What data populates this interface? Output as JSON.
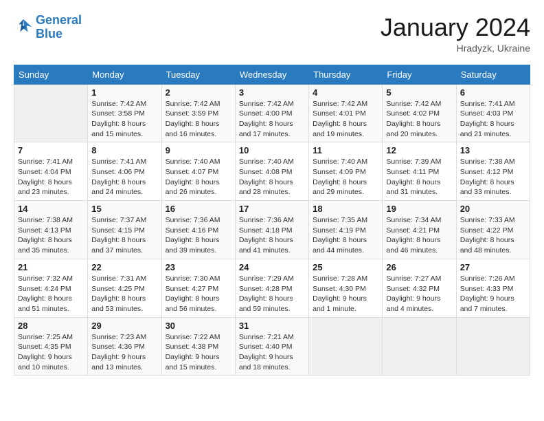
{
  "header": {
    "logo_line1": "General",
    "logo_line2": "Blue",
    "month_title": "January 2024",
    "location": "Hradyzk, Ukraine"
  },
  "days_of_week": [
    "Sunday",
    "Monday",
    "Tuesday",
    "Wednesday",
    "Thursday",
    "Friday",
    "Saturday"
  ],
  "weeks": [
    [
      {
        "day": "",
        "detail": ""
      },
      {
        "day": "1",
        "detail": "Sunrise: 7:42 AM\nSunset: 3:58 PM\nDaylight: 8 hours\nand 15 minutes."
      },
      {
        "day": "2",
        "detail": "Sunrise: 7:42 AM\nSunset: 3:59 PM\nDaylight: 8 hours\nand 16 minutes."
      },
      {
        "day": "3",
        "detail": "Sunrise: 7:42 AM\nSunset: 4:00 PM\nDaylight: 8 hours\nand 17 minutes."
      },
      {
        "day": "4",
        "detail": "Sunrise: 7:42 AM\nSunset: 4:01 PM\nDaylight: 8 hours\nand 19 minutes."
      },
      {
        "day": "5",
        "detail": "Sunrise: 7:42 AM\nSunset: 4:02 PM\nDaylight: 8 hours\nand 20 minutes."
      },
      {
        "day": "6",
        "detail": "Sunrise: 7:41 AM\nSunset: 4:03 PM\nDaylight: 8 hours\nand 21 minutes."
      }
    ],
    [
      {
        "day": "7",
        "detail": "Sunrise: 7:41 AM\nSunset: 4:04 PM\nDaylight: 8 hours\nand 23 minutes."
      },
      {
        "day": "8",
        "detail": "Sunrise: 7:41 AM\nSunset: 4:06 PM\nDaylight: 8 hours\nand 24 minutes."
      },
      {
        "day": "9",
        "detail": "Sunrise: 7:40 AM\nSunset: 4:07 PM\nDaylight: 8 hours\nand 26 minutes."
      },
      {
        "day": "10",
        "detail": "Sunrise: 7:40 AM\nSunset: 4:08 PM\nDaylight: 8 hours\nand 28 minutes."
      },
      {
        "day": "11",
        "detail": "Sunrise: 7:40 AM\nSunset: 4:09 PM\nDaylight: 8 hours\nand 29 minutes."
      },
      {
        "day": "12",
        "detail": "Sunrise: 7:39 AM\nSunset: 4:11 PM\nDaylight: 8 hours\nand 31 minutes."
      },
      {
        "day": "13",
        "detail": "Sunrise: 7:38 AM\nSunset: 4:12 PM\nDaylight: 8 hours\nand 33 minutes."
      }
    ],
    [
      {
        "day": "14",
        "detail": "Sunrise: 7:38 AM\nSunset: 4:13 PM\nDaylight: 8 hours\nand 35 minutes."
      },
      {
        "day": "15",
        "detail": "Sunrise: 7:37 AM\nSunset: 4:15 PM\nDaylight: 8 hours\nand 37 minutes."
      },
      {
        "day": "16",
        "detail": "Sunrise: 7:36 AM\nSunset: 4:16 PM\nDaylight: 8 hours\nand 39 minutes."
      },
      {
        "day": "17",
        "detail": "Sunrise: 7:36 AM\nSunset: 4:18 PM\nDaylight: 8 hours\nand 41 minutes."
      },
      {
        "day": "18",
        "detail": "Sunrise: 7:35 AM\nSunset: 4:19 PM\nDaylight: 8 hours\nand 44 minutes."
      },
      {
        "day": "19",
        "detail": "Sunrise: 7:34 AM\nSunset: 4:21 PM\nDaylight: 8 hours\nand 46 minutes."
      },
      {
        "day": "20",
        "detail": "Sunrise: 7:33 AM\nSunset: 4:22 PM\nDaylight: 8 hours\nand 48 minutes."
      }
    ],
    [
      {
        "day": "21",
        "detail": "Sunrise: 7:32 AM\nSunset: 4:24 PM\nDaylight: 8 hours\nand 51 minutes."
      },
      {
        "day": "22",
        "detail": "Sunrise: 7:31 AM\nSunset: 4:25 PM\nDaylight: 8 hours\nand 53 minutes."
      },
      {
        "day": "23",
        "detail": "Sunrise: 7:30 AM\nSunset: 4:27 PM\nDaylight: 8 hours\nand 56 minutes."
      },
      {
        "day": "24",
        "detail": "Sunrise: 7:29 AM\nSunset: 4:28 PM\nDaylight: 8 hours\nand 59 minutes."
      },
      {
        "day": "25",
        "detail": "Sunrise: 7:28 AM\nSunset: 4:30 PM\nDaylight: 9 hours\nand 1 minute."
      },
      {
        "day": "26",
        "detail": "Sunrise: 7:27 AM\nSunset: 4:32 PM\nDaylight: 9 hours\nand 4 minutes."
      },
      {
        "day": "27",
        "detail": "Sunrise: 7:26 AM\nSunset: 4:33 PM\nDaylight: 9 hours\nand 7 minutes."
      }
    ],
    [
      {
        "day": "28",
        "detail": "Sunrise: 7:25 AM\nSunset: 4:35 PM\nDaylight: 9 hours\nand 10 minutes."
      },
      {
        "day": "29",
        "detail": "Sunrise: 7:23 AM\nSunset: 4:36 PM\nDaylight: 9 hours\nand 13 minutes."
      },
      {
        "day": "30",
        "detail": "Sunrise: 7:22 AM\nSunset: 4:38 PM\nDaylight: 9 hours\nand 15 minutes."
      },
      {
        "day": "31",
        "detail": "Sunrise: 7:21 AM\nSunset: 4:40 PM\nDaylight: 9 hours\nand 18 minutes."
      },
      {
        "day": "",
        "detail": ""
      },
      {
        "day": "",
        "detail": ""
      },
      {
        "day": "",
        "detail": ""
      }
    ]
  ]
}
